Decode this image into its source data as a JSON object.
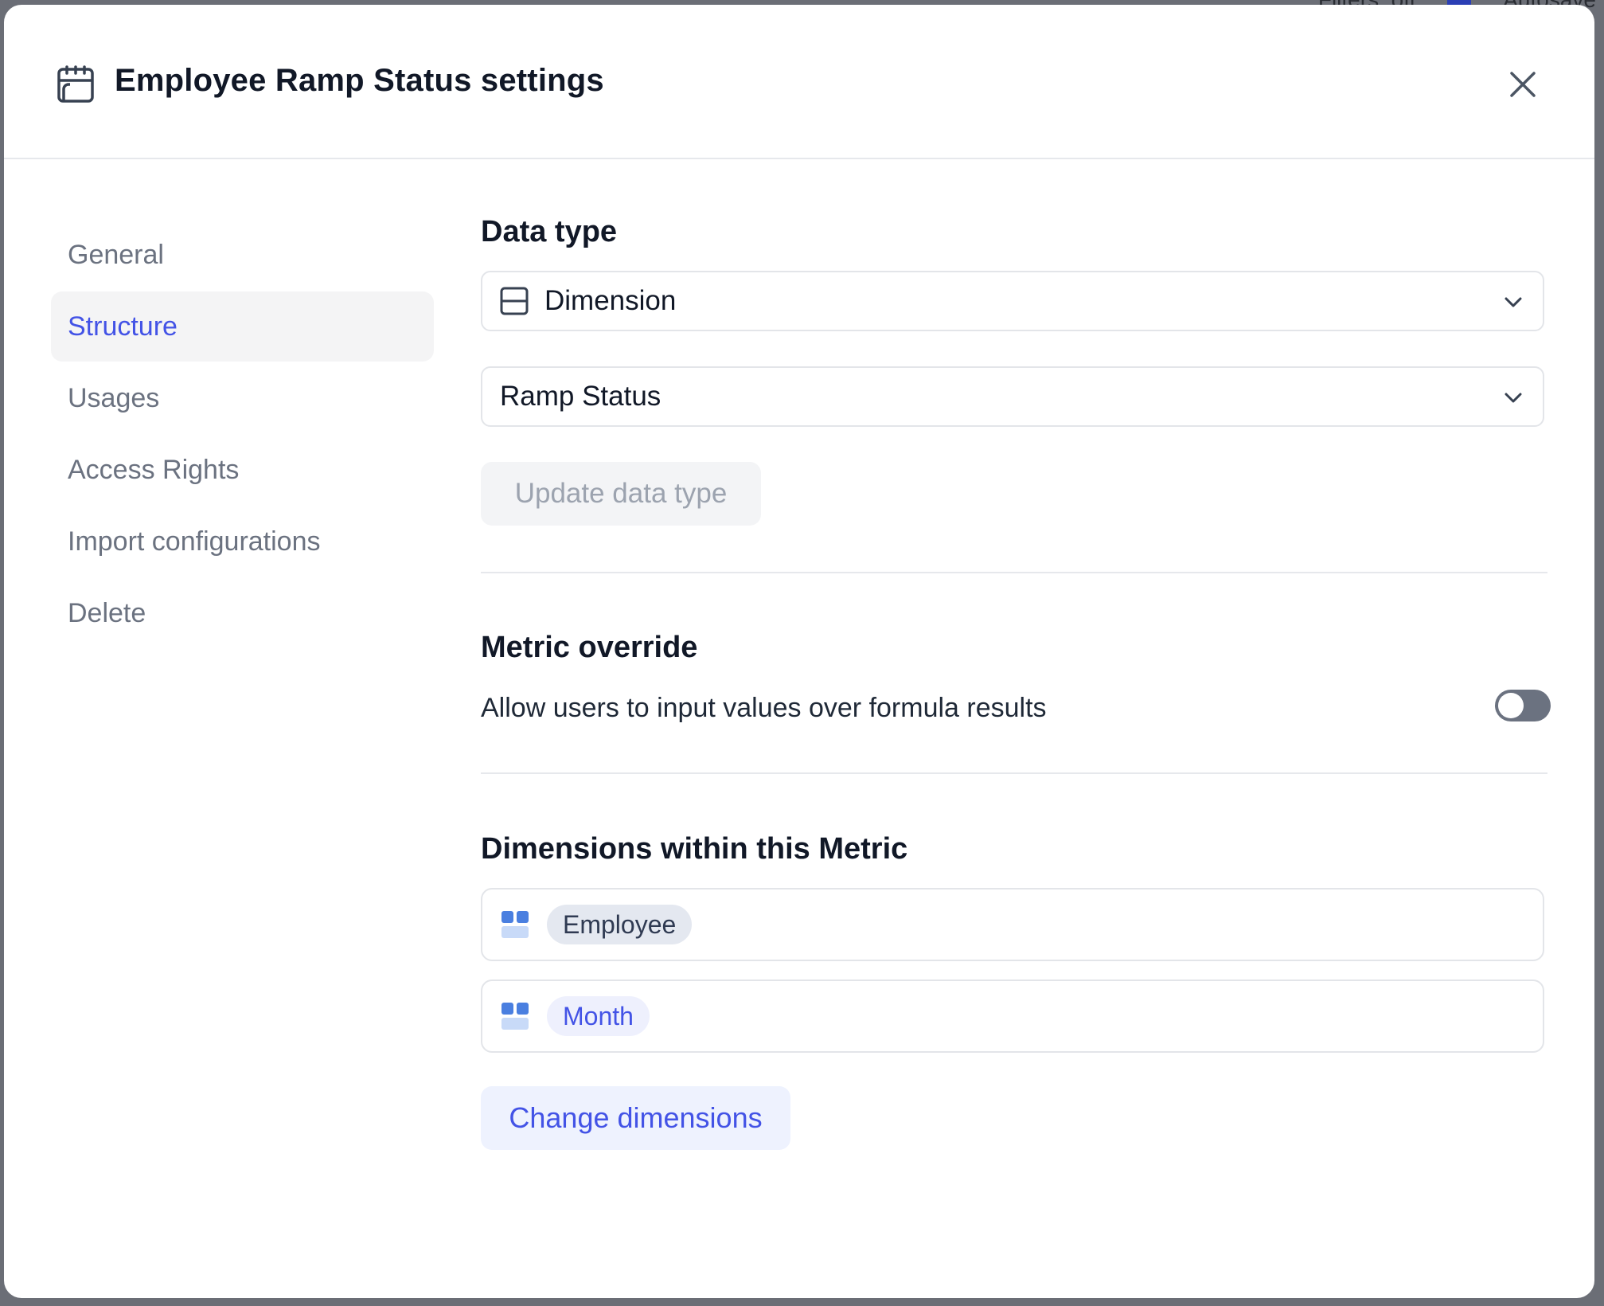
{
  "backdrop": {
    "partial_text_1": "Filters: off",
    "partial_text_2": "Autosave",
    "accent_color": "#2b3fb5"
  },
  "modal": {
    "title": "Employee Ramp Status settings",
    "header_icon": "metric-calendar-icon",
    "close_icon": "close-icon"
  },
  "sidebar": {
    "items": [
      {
        "label": "General",
        "active": false
      },
      {
        "label": "Structure",
        "active": true
      },
      {
        "label": "Usages",
        "active": false
      },
      {
        "label": "Access Rights",
        "active": false
      },
      {
        "label": "Import configurations",
        "active": false
      },
      {
        "label": "Delete",
        "active": false
      }
    ]
  },
  "data_type": {
    "heading": "Data type",
    "type_select": {
      "value": "Dimension",
      "icon": "dimension-icon"
    },
    "dimension_select": {
      "value": "Ramp Status"
    },
    "update_button": "Update data type"
  },
  "metric_override": {
    "heading": "Metric override",
    "description": "Allow users to input values over formula results",
    "toggle_on": false
  },
  "dimensions": {
    "heading": "Dimensions within this Metric",
    "items": [
      {
        "label": "Employee",
        "icon": "dimension-grid-icon"
      },
      {
        "label": "Month",
        "icon": "dimension-grid-icon"
      }
    ],
    "change_button": "Change dimensions"
  },
  "colors": {
    "accent": "#4353e6",
    "active_nav_bg": "#f4f4f5",
    "toggle_off": "#6b7280"
  }
}
